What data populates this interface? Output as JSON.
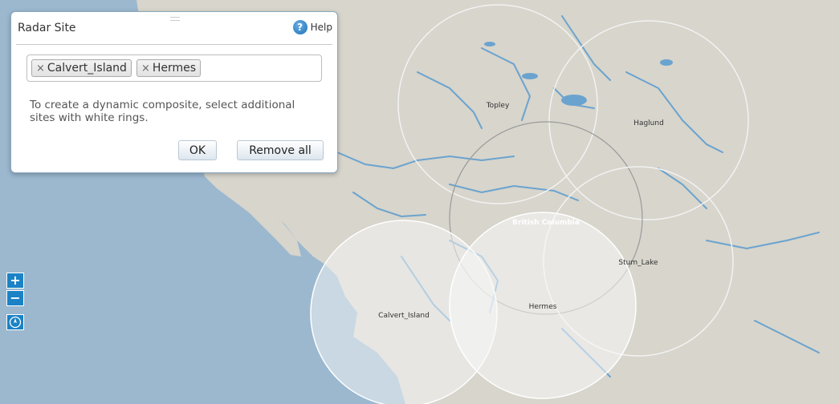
{
  "dialog": {
    "title": "Radar Site",
    "help_label": "Help",
    "selected_sites": [
      {
        "label": "Calvert_Island"
      },
      {
        "label": "Hermes"
      }
    ],
    "message": "To create a dynamic composite, select additional sites with white rings.",
    "ok_label": "OK",
    "remove_all_label": "Remove all"
  },
  "map": {
    "region_label": "British Columbia",
    "sites": [
      {
        "name": "Topley",
        "ring": "white"
      },
      {
        "name": "Haglund",
        "ring": "white"
      },
      {
        "name": "Stum_Lake",
        "ring": "white"
      },
      {
        "name": "Calvert_Island",
        "ring": "selected"
      },
      {
        "name": "Hermes",
        "ring": "selected"
      }
    ],
    "colors": {
      "water": "#9ab8cf",
      "land": "#d6d4cb",
      "rivers": "#6ba3cf"
    }
  },
  "controls": {
    "zoom_in_label": "+",
    "zoom_out_label": "−",
    "compass_icon": "compass-icon"
  }
}
